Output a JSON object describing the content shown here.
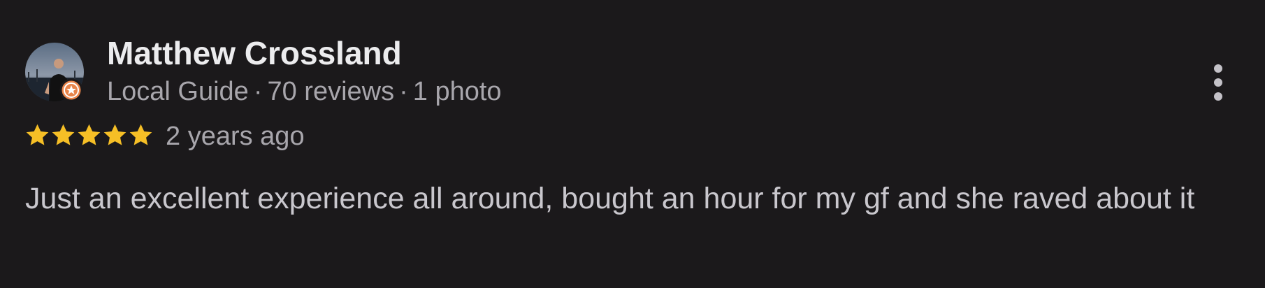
{
  "review": {
    "author_name": "Matthew Crossland",
    "author_badge": "Local Guide",
    "review_count": "70 reviews",
    "photo_count": "1 photo",
    "separator": "·",
    "rating": 5,
    "rating_max": 5,
    "time_ago": "2 years ago",
    "text": "Just an excellent experience all around, bought an hour for my gf and she raved about it",
    "icons": {
      "more": "more-vert-icon",
      "star": "star-icon",
      "badge": "local-guide-badge-icon"
    },
    "colors": {
      "background": "#1b191b",
      "star": "#f6bf26",
      "badge": "#e8844a"
    }
  }
}
